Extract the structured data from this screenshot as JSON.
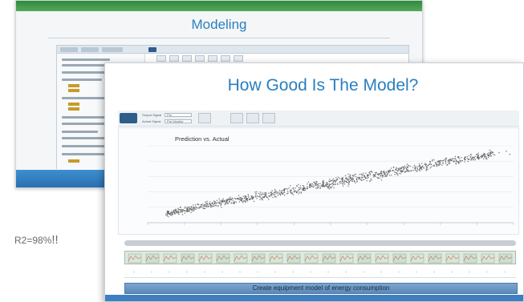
{
  "back_slide": {
    "title": "Modeling",
    "colors": {
      "header_bar": "#2f8b3a",
      "title": "#2a7fbf",
      "bottom_band": "#2a6fb0"
    }
  },
  "front_slide": {
    "title": "How Good Is The Model?",
    "toolbar": {
      "field_1_label": "Output Signal",
      "field_1_value": "Pre",
      "field_2_label": "Actual Signal",
      "field_2_value": "Pre Monitor"
    },
    "plot": {
      "title": "Prediction vs. Actual"
    },
    "caption": "Create equipment model of energy consumption",
    "colors": {
      "title": "#2a7fbf",
      "caption_bar": "#5b88b8",
      "points": "#555555"
    }
  },
  "side_note": {
    "text": "R2=98%",
    "emphasis": "!!"
  },
  "chart_data": {
    "type": "scatter",
    "title": "Prediction vs. Actual",
    "xlabel": "",
    "ylabel": "",
    "x_range": [
      0,
      100
    ],
    "y_range": [
      0,
      100
    ],
    "trend": "strong positive linear relationship",
    "series": [
      {
        "points": [
          [
            5,
            12
          ],
          [
            10,
            16
          ],
          [
            15,
            22
          ],
          [
            20,
            26
          ],
          [
            25,
            30
          ],
          [
            30,
            35
          ],
          [
            35,
            38
          ],
          [
            40,
            43
          ],
          [
            45,
            48
          ],
          [
            50,
            51
          ],
          [
            55,
            56
          ],
          [
            60,
            60
          ],
          [
            65,
            64
          ],
          [
            70,
            69
          ],
          [
            75,
            73
          ],
          [
            80,
            78
          ],
          [
            85,
            82
          ],
          [
            90,
            86
          ],
          [
            95,
            90
          ]
        ]
      }
    ]
  }
}
